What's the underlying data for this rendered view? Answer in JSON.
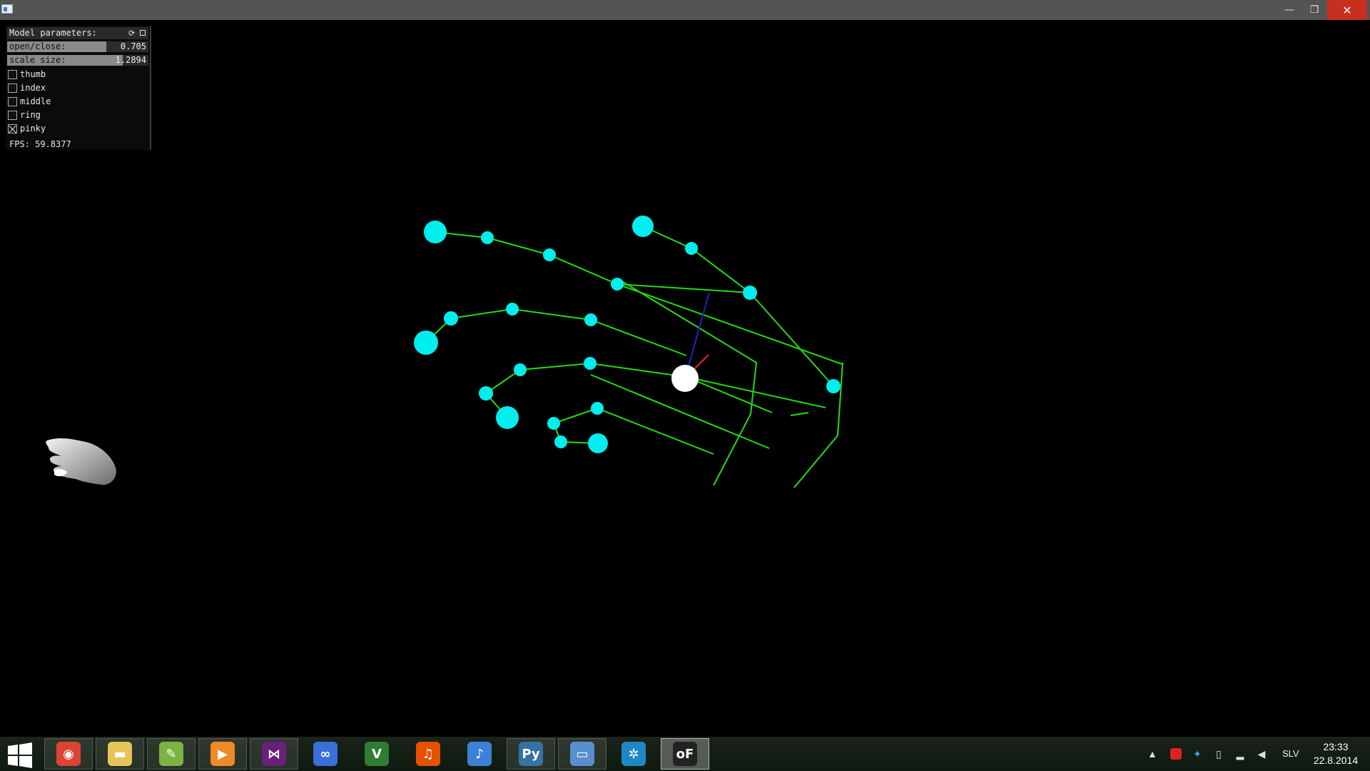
{
  "window": {
    "minimize_glyph": "—",
    "maximize_glyph": "❐",
    "close_glyph": "✕"
  },
  "panel": {
    "title": "Model parameters:",
    "reload_glyph": "⟳",
    "sliders": [
      {
        "label": "open/close:",
        "value": "0.705",
        "fraction": 0.705
      },
      {
        "label": "scale size:",
        "value": "1.2894",
        "fraction": 0.82
      }
    ],
    "checkboxes": [
      {
        "label": "thumb",
        "checked": false
      },
      {
        "label": "index",
        "checked": false
      },
      {
        "label": "middle",
        "checked": false
      },
      {
        "label": "ring",
        "checked": false
      },
      {
        "label": "pinky",
        "checked": true
      }
    ],
    "fps": "FPS: 59.8377"
  },
  "scene": {
    "bone_color": "#22dd11",
    "joint_color": "#00eeee",
    "palm_color": "#ffffff",
    "axis_colors": {
      "x": "#ee2222",
      "y": "#22cc22",
      "z": "#2222cc"
    }
  },
  "taskbar": {
    "apps": [
      {
        "name": "chrome",
        "icon": "chrome-icon",
        "color": "#dd4433"
      },
      {
        "name": "file-explorer",
        "icon": "folder-icon",
        "color": "#e7c35a"
      },
      {
        "name": "notepad++",
        "icon": "notepad-icon",
        "color": "#7cb342"
      },
      {
        "name": "media-player",
        "icon": "play-icon",
        "color": "#f08a24"
      },
      {
        "name": "visual-studio",
        "icon": "visual-studio-icon",
        "color": "#68217a"
      },
      {
        "name": "infinity-app",
        "icon": "infinity-icon",
        "color": "#3a6fd8"
      },
      {
        "name": "vim",
        "icon": "vim-icon",
        "color": "#2e7d32"
      },
      {
        "name": "audacity",
        "icon": "headphones-icon",
        "color": "#e65100"
      },
      {
        "name": "itunes",
        "icon": "music-icon",
        "color": "#3b82d6"
      },
      {
        "name": "python",
        "icon": "python-icon",
        "color": "#3572a5"
      },
      {
        "name": "remote-desktop",
        "icon": "monitor-icon",
        "color": "#5a8fcf"
      },
      {
        "name": "tree-app",
        "icon": "tree-icon",
        "color": "#1e88c7"
      },
      {
        "name": "openframeworks",
        "icon": "of-icon",
        "color": "#222222",
        "active": true
      }
    ],
    "tray": {
      "language": "SLV",
      "time": "23:33",
      "date": "22.8.2014",
      "up_arrow_glyph": "▲",
      "icons": [
        "network-warning-icon",
        "dropbox-icon",
        "battery-icon",
        "signal-icon",
        "volume-icon"
      ]
    }
  }
}
